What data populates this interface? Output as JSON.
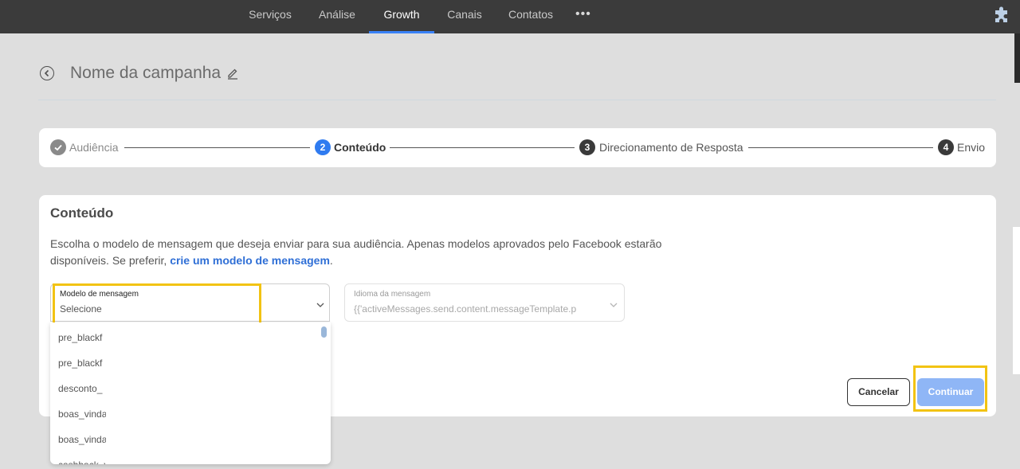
{
  "nav": {
    "items": [
      {
        "label": "Serviços",
        "active": false
      },
      {
        "label": "Análise",
        "active": false
      },
      {
        "label": "Growth",
        "active": true
      },
      {
        "label": "Canais",
        "active": false
      },
      {
        "label": "Contatos",
        "active": false
      }
    ],
    "more_label": "•••"
  },
  "header": {
    "title": "Nome da campanha"
  },
  "stepper": {
    "steps": [
      {
        "number": "",
        "label": "Audiência",
        "state": "done"
      },
      {
        "number": "2",
        "label": "Conteúdo",
        "state": "current"
      },
      {
        "number": "3",
        "label": "Direcionamento de Resposta",
        "state": "pending"
      },
      {
        "number": "4",
        "label": "Envio",
        "state": "pending"
      }
    ]
  },
  "content": {
    "title": "Conteúdo",
    "description": "Escolha o modelo de mensagem que deseja enviar para sua audiência. Apenas modelos aprovados pelo Facebook estarão disponíveis. Se preferir,",
    "link": "crie um modelo de mensagem",
    "link_suffix": ".",
    "template_field": {
      "label": "Modelo de mensagem",
      "value": "Selecione"
    },
    "language_field": {
      "label": "Idioma da mensagem",
      "value": "{{'activeMessages.send.content.messageTemplate.p"
    },
    "cancel_label": "Cancelar",
    "continue_label": "Continuar"
  },
  "dropdown": {
    "options": [
      "pre_blackf",
      "pre_blackf",
      "desconto_",
      "boas_vindas",
      "boas_vindasj",
      "cashback_valido"
    ]
  },
  "colors": {
    "nav_bg": "#3b3b3b",
    "accent": "#3a82f7",
    "link": "#2f6fd6",
    "highlight": "#f2c313",
    "continue_disabled": "#8fb6f6"
  }
}
